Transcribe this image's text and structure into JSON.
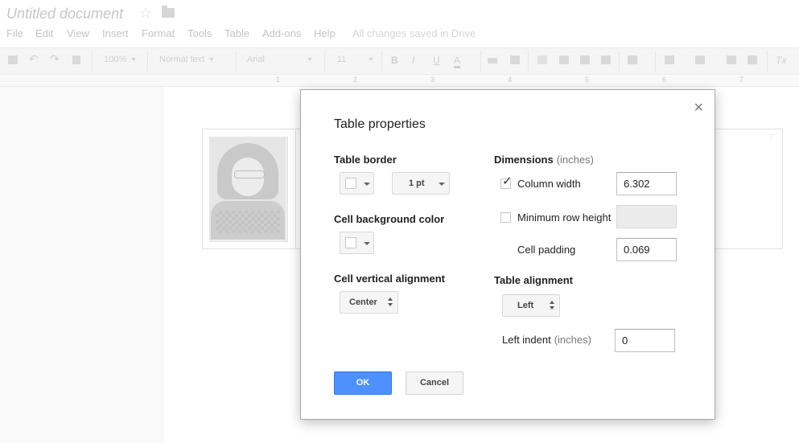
{
  "document": {
    "title": "Untitled document",
    "save_status": "All changes saved in Drive"
  },
  "menu": {
    "items": [
      "File",
      "Edit",
      "View",
      "Insert",
      "Format",
      "Tools",
      "Table",
      "Add-ons",
      "Help"
    ]
  },
  "toolbar": {
    "zoom": "100%",
    "style": "Normal text",
    "font": "Arial",
    "size": "11",
    "bold": "B",
    "italic": "I",
    "underline": "U",
    "text_color": "A",
    "clear_format": "Tx"
  },
  "ruler": {
    "marks": [
      "1",
      "2",
      "3",
      "4",
      "5",
      "6",
      "7"
    ]
  },
  "dialog": {
    "title": "Table properties",
    "close_label": "×",
    "table_border": {
      "label": "Table border",
      "width_value": "1 pt"
    },
    "cell_background": {
      "label": "Cell background color"
    },
    "cell_vertical_alignment": {
      "label": "Cell vertical alignment",
      "value": "Center"
    },
    "dimensions": {
      "label": "Dimensions",
      "unit": "(inches)",
      "column_width": {
        "label": "Column width",
        "checked": true,
        "value": "6.302"
      },
      "min_row_height": {
        "label": "Minimum row height",
        "checked": false,
        "value": ""
      },
      "cell_padding": {
        "label": "Cell padding",
        "value": "0.069"
      }
    },
    "table_alignment": {
      "label": "Table alignment",
      "value": "Left",
      "left_indent": {
        "label": "Left indent",
        "unit": "(inches)",
        "value": "0"
      }
    },
    "ok_label": "OK",
    "cancel_label": "Cancel"
  },
  "colors": {
    "primary_button": "#4d90fe",
    "dialog_border": "#a9a9a9"
  }
}
